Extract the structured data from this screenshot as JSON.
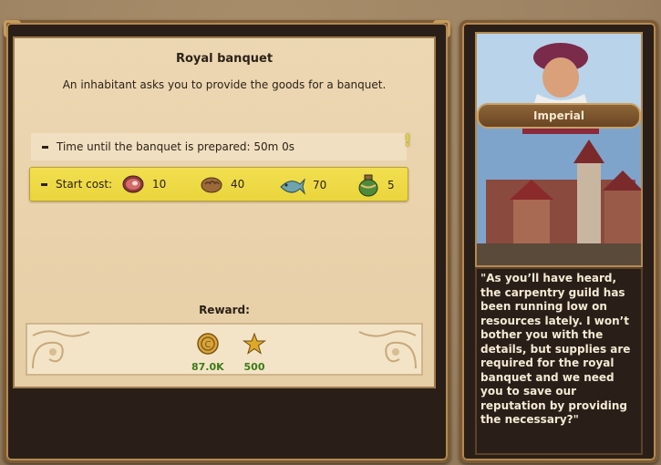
{
  "quest": {
    "title": "Royal banquet",
    "description": "An inhabitant asks you to provide the goods for a banquet.",
    "time_text": "Time until the banquet is prepared: 50m 0s",
    "start_cost_label": "Start cost:",
    "costs": [
      {
        "icon": "meat-icon",
        "amount": "10"
      },
      {
        "icon": "bread-icon",
        "amount": "40"
      },
      {
        "icon": "fish-icon",
        "amount": "70"
      },
      {
        "icon": "wine-bottle-icon",
        "amount": "5"
      }
    ],
    "alert": "!",
    "reward_label": "Reward:",
    "rewards": [
      {
        "icon": "coin-icon",
        "amount": "87.0K"
      },
      {
        "icon": "star-icon",
        "amount": "500"
      }
    ]
  },
  "side": {
    "npc_name": "Imperial",
    "quote": "\"As you’ll have heard, the carpentry guild has been running low on resources lately. I won’t bother you with the details, but supplies are required for the royal banquet and we need you to save our reputation by providing the necessary?\""
  },
  "colors": {
    "cost_highlight": "#eeda44",
    "reward_value": "#3d7b18",
    "parchment": "#ecd7b3"
  }
}
